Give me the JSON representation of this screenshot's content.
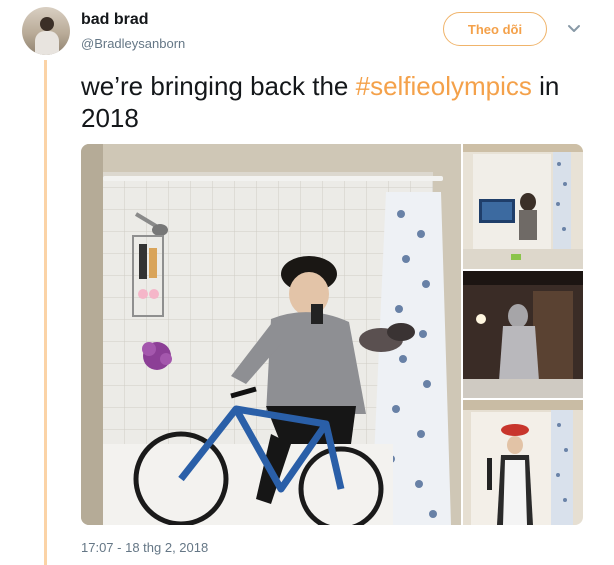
{
  "tweet": {
    "display_name": "bad brad",
    "handle": "@Bradleysanborn",
    "follow_label": "Theo dõi",
    "text_before": "we’re bringing back the ",
    "hashtag": "#selfieolympics",
    "text_after": " in 2018",
    "timestamp": "17:07 - 18 thg 2, 2018"
  },
  "media": {
    "photos": [
      {
        "subject": "person in gray hoodie taking a mirror selfie on a blue bicycle inside a bathtub shower"
      },
      {
        "subject": "bathroom mirror selfie with a tv reflected"
      },
      {
        "subject": "dark bathroom mirror selfie with person in hood"
      },
      {
        "subject": "mirror selfie wearing a red hat, scarf and apron holding a spatula"
      }
    ]
  },
  "icons": {
    "chevron": "chevron-down-icon",
    "avatar": "avatar"
  },
  "colors": {
    "accent": "#f4a14a",
    "accent_bar": "#fbd3a6",
    "muted": "#657786"
  }
}
